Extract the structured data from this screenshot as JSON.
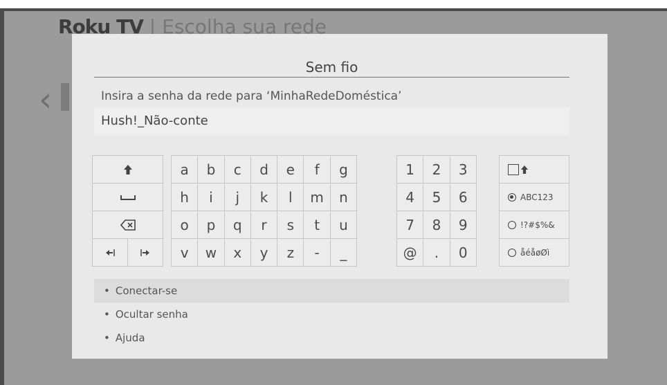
{
  "brand": {
    "logo": "Roku TV",
    "separator": "|",
    "page_title": "Escolha sua rede"
  },
  "dialog": {
    "title": "Sem fio",
    "prompt": "Insira a senha da rede para  ‘MinhaRedeDoméstica’",
    "password_value": "Hush!_Não-conte"
  },
  "keyboard": {
    "letters": [
      "a",
      "b",
      "c",
      "d",
      "e",
      "f",
      "g",
      "h",
      "i",
      "j",
      "k",
      "l",
      "m",
      "n",
      "o",
      "p",
      "q",
      "r",
      "s",
      "t",
      "u",
      "v",
      "w",
      "x",
      "y",
      "z",
      "-",
      "_"
    ],
    "numbers": [
      "1",
      "2",
      "3",
      "4",
      "5",
      "6",
      "7",
      "8",
      "9",
      "@",
      ".",
      "0"
    ],
    "modes": {
      "caps_icon": "caps-lock-icon",
      "abc123": "ABC123",
      "symbols": "!?#$%&",
      "accents": "åéåøØì",
      "selected": "ABC123"
    }
  },
  "options": [
    {
      "label": "Conectar-se"
    },
    {
      "label": "Ocultar senha"
    },
    {
      "label": "Ajuda"
    }
  ],
  "option_bullet": "•"
}
